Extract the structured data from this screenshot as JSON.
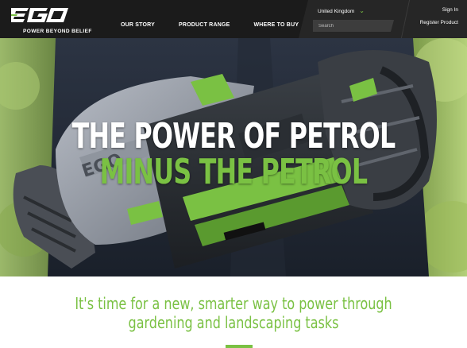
{
  "brand": {
    "logo_text": "EGO",
    "tagline": "POWER BEYOND BELIEF"
  },
  "nav": {
    "items": [
      {
        "label": "OUR STORY"
      },
      {
        "label": "PRODUCT RANGE"
      },
      {
        "label": "WHERE TO BUY"
      }
    ]
  },
  "header": {
    "country": "United Kingdom",
    "search_placeholder": "Search",
    "signin_label": "Sign In",
    "register_label": "Register Product"
  },
  "hero": {
    "headline_line1": "THE POWER OF PETROL",
    "headline_line2": "MINUS THE PETROL",
    "product_badge": "EGO"
  },
  "intro": {
    "line1": "It's time for a new, smarter way to power through",
    "line2": "gardening and landscaping tasks"
  },
  "colors": {
    "brand_green": "#7ac143",
    "header_bg": "#1b1b1b",
    "text_white": "#ffffff"
  },
  "icons": {
    "country_selector": "chevron-down-icon"
  }
}
